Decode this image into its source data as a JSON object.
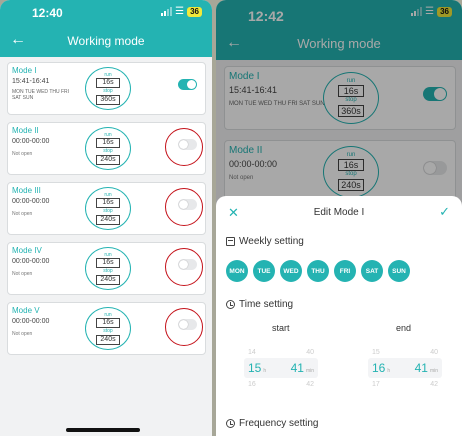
{
  "left": {
    "status_time": "12:40",
    "battery": "36",
    "title": "Working mode",
    "modes": [
      {
        "name": "Mode I",
        "time": "15:41-16:41",
        "days": "MON TUE WED THU FRI SAT SUN",
        "status": "",
        "run_label": "run",
        "run": "16s",
        "stop_label": "stop",
        "stop": "360s",
        "on": true
      },
      {
        "name": "Mode II",
        "time": "00:00-00:00",
        "days": "",
        "status": "Not open",
        "run_label": "run",
        "run": "16s",
        "stop_label": "stop",
        "stop": "240s",
        "on": false
      },
      {
        "name": "Mode III",
        "time": "00:00-00:00",
        "days": "",
        "status": "Not open",
        "run_label": "run",
        "run": "16s",
        "stop_label": "stop",
        "stop": "240s",
        "on": false
      },
      {
        "name": "Mode IV",
        "time": "00:00-00:00",
        "days": "",
        "status": "Not open",
        "run_label": "run",
        "run": "16s",
        "stop_label": "stop",
        "stop": "240s",
        "on": false
      },
      {
        "name": "Mode V",
        "time": "00:00-00:00",
        "days": "",
        "status": "Not open",
        "run_label": "run",
        "run": "16s",
        "stop_label": "stop",
        "stop": "240s",
        "on": false
      }
    ]
  },
  "right": {
    "status_time": "12:42",
    "battery": "36",
    "title": "Working mode",
    "modes": [
      {
        "name": "Mode I",
        "time": "15:41-16:41",
        "days": "MON TUE WED THU FRI SAT SUN",
        "status": "",
        "run_label": "run",
        "run": "16s",
        "stop_label": "stop",
        "stop": "360s",
        "on": true
      },
      {
        "name": "Mode II",
        "time": "00:00-00:00",
        "days": "",
        "status": "Not open",
        "run_label": "run",
        "run": "16s",
        "stop_label": "stop",
        "stop": "240s",
        "on": false
      }
    ],
    "sheet": {
      "title": "Edit Mode I",
      "weekly_label": "Weekly setting",
      "days": [
        "MON",
        "TUE",
        "WED",
        "THU",
        "FRI",
        "SAT",
        "SUN"
      ],
      "time_label": "Time setting",
      "start_label": "start",
      "end_label": "end",
      "start_picker": {
        "hour_prev": "14",
        "min_prev": "40",
        "hour": "15",
        "min": "41",
        "hour_next": "16",
        "min_next": "42",
        "h_unit": "h",
        "m_unit": "min"
      },
      "end_picker": {
        "hour_prev": "15",
        "min_prev": "40",
        "hour": "16",
        "min": "41",
        "hour_next": "17",
        "min_next": "42",
        "h_unit": "h",
        "m_unit": "min"
      },
      "frequency_label": "Frequency setting"
    }
  },
  "colors": {
    "accent": "#24b3b2",
    "annotation": "#c4121a"
  }
}
